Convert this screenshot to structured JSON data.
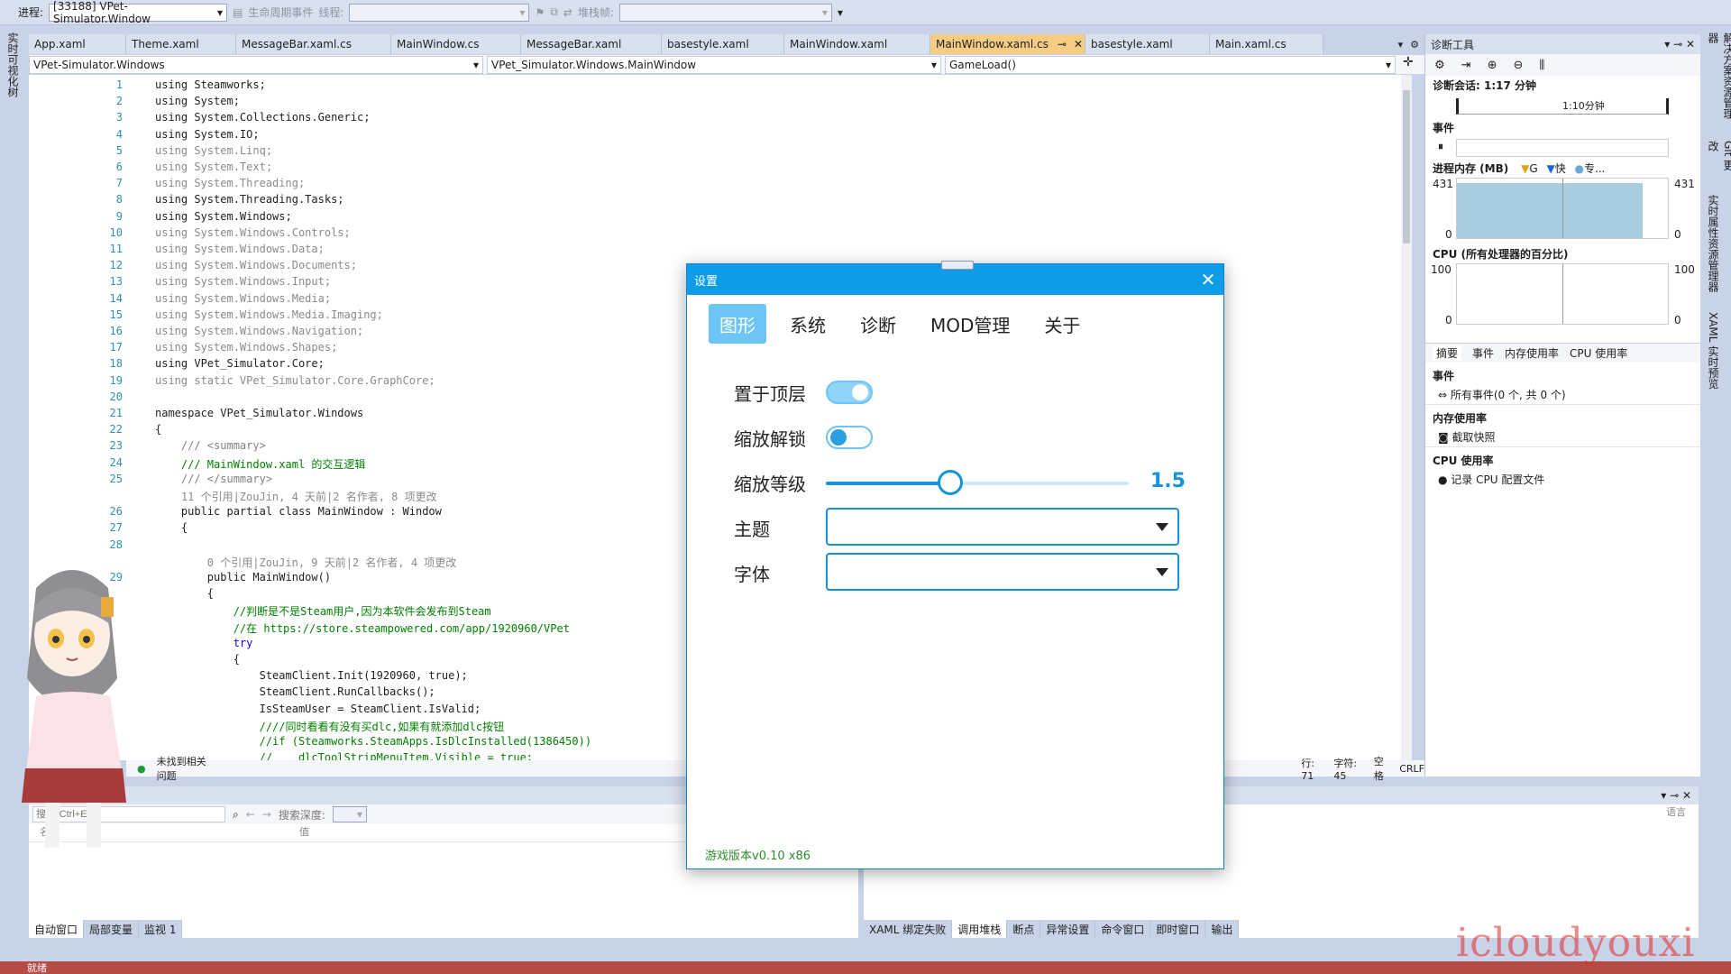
{
  "toolbar": {
    "process_label": "进程:",
    "process_value": "[33188] VPet-Simulator.Window",
    "lifecycle_label": "生命周期事件",
    "thread_label": "线程:",
    "stack_label": "堆栈帧:"
  },
  "left_rail": {
    "label": "实时可视化树"
  },
  "right_rail": {
    "labels": [
      "解决方案资源管理器",
      "Git 更改",
      "实时属性资源管理器",
      "XAML 实时预览"
    ]
  },
  "tabs": [
    {
      "label": "App.xaml",
      "active": false
    },
    {
      "label": "Theme.xaml",
      "active": false
    },
    {
      "label": "MessageBar.xaml.cs",
      "active": false
    },
    {
      "label": "MainWindow.cs",
      "active": false
    },
    {
      "label": "MessageBar.xaml",
      "active": false
    },
    {
      "label": "basestyle.xaml",
      "active": false
    },
    {
      "label": "MainWindow.xaml",
      "active": false
    },
    {
      "label": "MainWindow.xaml.cs",
      "active": true
    },
    {
      "label": "basestyle.xaml",
      "active": false
    },
    {
      "label": "Main.xaml.cs",
      "active": false
    }
  ],
  "navbar": {
    "project": "VPet-Simulator.Windows",
    "class": "VPet_Simulator.Windows.MainWindow",
    "member": "GameLoad()"
  },
  "code_lines": [
    {
      "n": "1",
      "text": "using Steamworks;",
      "color": "#1e1e1e"
    },
    {
      "n": "2",
      "text": "using System;",
      "color": "#1e1e1e"
    },
    {
      "n": "3",
      "text": "using System.Collections.Generic;",
      "color": "#1e1e1e"
    },
    {
      "n": "4",
      "text": "using System.IO;",
      "color": "#1e1e1e"
    },
    {
      "n": "5",
      "text": "using System.Linq;",
      "color": "#8a8a8a"
    },
    {
      "n": "6",
      "text": "using System.Text;",
      "color": "#8a8a8a"
    },
    {
      "n": "7",
      "text": "using System.Threading;",
      "color": "#8a8a8a"
    },
    {
      "n": "8",
      "text": "using System.Threading.Tasks;",
      "color": "#1e1e1e"
    },
    {
      "n": "9",
      "text": "using System.Windows;",
      "color": "#1e1e1e"
    },
    {
      "n": "10",
      "text": "using System.Windows.Controls;",
      "color": "#8a8a8a"
    },
    {
      "n": "11",
      "text": "using System.Windows.Data;",
      "color": "#8a8a8a"
    },
    {
      "n": "12",
      "text": "using System.Windows.Documents;",
      "color": "#8a8a8a"
    },
    {
      "n": "13",
      "text": "using System.Windows.Input;",
      "color": "#8a8a8a"
    },
    {
      "n": "14",
      "text": "using System.Windows.Media;",
      "color": "#8a8a8a"
    },
    {
      "n": "15",
      "text": "using System.Windows.Media.Imaging;",
      "color": "#8a8a8a"
    },
    {
      "n": "16",
      "text": "using System.Windows.Navigation;",
      "color": "#8a8a8a"
    },
    {
      "n": "17",
      "text": "using System.Windows.Shapes;",
      "color": "#8a8a8a"
    },
    {
      "n": "18",
      "text": "using VPet_Simulator.Core;",
      "color": "#1e1e1e"
    },
    {
      "n": "19",
      "text": "using static VPet_Simulator.Core.GraphCore;",
      "color": "#8a8a8a"
    },
    {
      "n": "20",
      "text": "",
      "color": "#1e1e1e"
    },
    {
      "n": "21",
      "text": "namespace VPet_Simulator.Windows",
      "color": "#1e1e1e"
    },
    {
      "n": "22",
      "text": "{",
      "color": "#1e1e1e"
    },
    {
      "n": "23",
      "text": "    /// <summary>",
      "color": "#808080"
    },
    {
      "n": "24",
      "text": "    /// MainWindow.xaml 的交互逻辑",
      "color": "#008000"
    },
    {
      "n": "25",
      "text": "    /// </summary>",
      "color": "#808080"
    },
    {
      "n": "",
      "text": "    11 个引用|ZouJin, 4 天前|2 名作者, 8 项更改",
      "color": "#8a8a8a"
    },
    {
      "n": "26",
      "text": "    public partial class MainWindow : Window",
      "color": "#1e1e1e"
    },
    {
      "n": "27",
      "text": "    {",
      "color": "#1e1e1e"
    },
    {
      "n": "28",
      "text": "",
      "color": "#1e1e1e"
    },
    {
      "n": "",
      "text": "        0 个引用|ZouJin, 9 天前|2 名作者, 4 项更改",
      "color": "#8a8a8a"
    },
    {
      "n": "29",
      "text": "        public MainWindow()",
      "color": "#1e1e1e"
    },
    {
      "n": "",
      "text": "        {",
      "color": "#1e1e1e"
    },
    {
      "n": "",
      "text": "            //判断是不是Steam用户,因为本软件会发布到Steam",
      "color": "#008000"
    },
    {
      "n": "",
      "text": "            //在 https://store.steampowered.com/app/1920960/VPet",
      "color": "#008000"
    },
    {
      "n": "",
      "text": "            try",
      "color": "#0000ff"
    },
    {
      "n": "",
      "text": "            {",
      "color": "#1e1e1e"
    },
    {
      "n": "",
      "text": "                SteamClient.Init(1920960, true);",
      "color": "#1e1e1e"
    },
    {
      "n": "",
      "text": "                SteamClient.RunCallbacks();",
      "color": "#1e1e1e"
    },
    {
      "n": "",
      "text": "                IsSteamUser = SteamClient.IsValid;",
      "color": "#1e1e1e"
    },
    {
      "n": "",
      "text": "                ////同时看看有没有买dlc,如果有就添加dlc按钮",
      "color": "#008000"
    },
    {
      "n": "",
      "text": "                //if (Steamworks.SteamApps.IsDlcInstalled(1386450))",
      "color": "#008000"
    },
    {
      "n": "",
      "text": "                //    dlcToolStripMenuItem.Visible = true;",
      "color": "#008000"
    }
  ],
  "editor_status": {
    "issues": "未找到相关问题",
    "line": "行: 71",
    "char": "字符: 45",
    "space": "空格",
    "crlf": "CRLF"
  },
  "diag": {
    "title": "诊断工具",
    "session": "诊断会话: 1:17 分钟",
    "timeline_mark": "1:10分钟",
    "events_label": "事件",
    "mem_label": "进程内存 (MB)",
    "mem_legend": [
      "G",
      "快",
      "专..."
    ],
    "mem_max": "431",
    "mem_min": "0",
    "mem_usage": 0.92,
    "cpu_label": "CPU (所有处理器的百分比)",
    "cpu_max": "100",
    "cpu_min": "0",
    "tabs": [
      "摘要",
      "事件",
      "内存使用率",
      "CPU 使用率"
    ],
    "section_events": "事件",
    "all_events": "所有事件(0 个, 共 0 个)",
    "section_mem": "内存使用率",
    "snapshot": "截取快照",
    "section_cpu": "CPU 使用率",
    "record_cpu": "记录 CPU 配置文件"
  },
  "bottom_left": {
    "title": "自动窗口",
    "search_placeholder": "搜索(Ctrl+E)",
    "search_depth": "搜索深度:",
    "col_name": "名称",
    "col_value": "值",
    "tabs": [
      "自动窗口",
      "局部变量",
      "监视 1"
    ]
  },
  "bottom_right": {
    "col_lang": "语言",
    "tabs": [
      "XAML 绑定失败",
      "调用堆栈",
      "断点",
      "异常设置",
      "命令窗口",
      "即时窗口",
      "输出"
    ]
  },
  "statusbar": {
    "ready": "就绪"
  },
  "dialog": {
    "title": "设置",
    "tabs": [
      "图形",
      "系统",
      "诊断",
      "MOD管理",
      "关于"
    ],
    "topmost_label": "置于顶层",
    "topmost_on": true,
    "scale_unlock_label": "缩放解锁",
    "scale_unlock_on": false,
    "zoom_label": "缩放等级",
    "zoom_value": "1.5",
    "zoom_fraction": 0.41,
    "theme_label": "主题",
    "font_label": "字体",
    "version": "游戏版本v0.10 x86"
  },
  "watermark": "icloudyouxi"
}
